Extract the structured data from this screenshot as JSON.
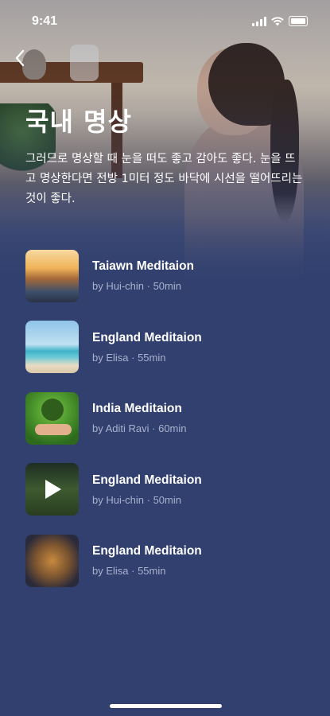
{
  "status_bar": {
    "time": "9:41"
  },
  "header": {
    "back_icon": "chevron-left-icon",
    "title": "국내 명상",
    "description": "그러므로 명상할 때 눈을 떠도 좋고 감아도 좋다. 눈을 뜨고 명상한다면 전방 1미터 정도 바닥에 시선을 떨어뜨리는 것이 좋다."
  },
  "list": {
    "items": [
      {
        "title": "Taiawn Meditaion",
        "meta": "by Hui-chin · 50min"
      },
      {
        "title": "England Meditaion",
        "meta": "by Elisa · 55min"
      },
      {
        "title": "India Meditaion",
        "meta": "by Aditi Ravi · 60min"
      },
      {
        "title": "England Meditaion",
        "meta": "by Hui-chin · 50min"
      },
      {
        "title": "England Meditaion",
        "meta": "by Elisa · 55min"
      }
    ]
  },
  "colors": {
    "background": "#31406f",
    "meta_text": "#a9b1cc",
    "text": "#ffffff"
  }
}
